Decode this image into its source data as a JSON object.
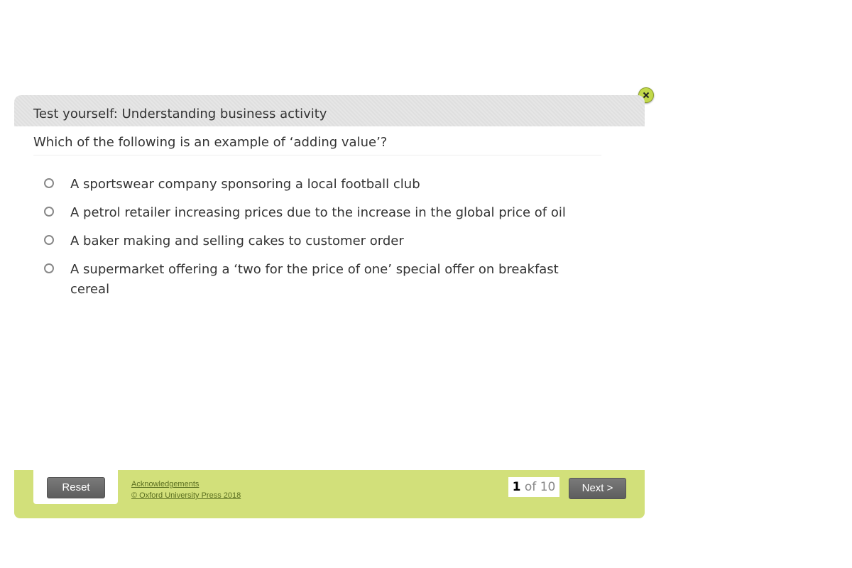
{
  "header": {
    "title": "Test yourself: Understanding business activity"
  },
  "question": {
    "text": "Which of the following is an example of ‘adding value’?"
  },
  "options": [
    {
      "label": "A sportswear company sponsoring a local football club"
    },
    {
      "label": "A petrol retailer increasing prices due to the increase in the global price of oil"
    },
    {
      "label": "A baker making and selling cakes to customer order"
    },
    {
      "label": "A supermarket offering a ‘two for the price of one’ special offer on breakfast cereal"
    }
  ],
  "footer": {
    "reset_label": "Reset",
    "acknowledgements_label": "Acknowledgements",
    "copyright_label": "© Oxford University Press 2018",
    "page_current": "1",
    "page_total_text": "of 10",
    "next_label": "Next >"
  },
  "icons": {
    "close": "close-icon",
    "radio": "radio-button-icon"
  },
  "colors": {
    "accent": "#d2e07a",
    "header_bg": "#e3e3e3",
    "button_bg": "#6e6e6e",
    "close_bg": "#c2d94a"
  }
}
